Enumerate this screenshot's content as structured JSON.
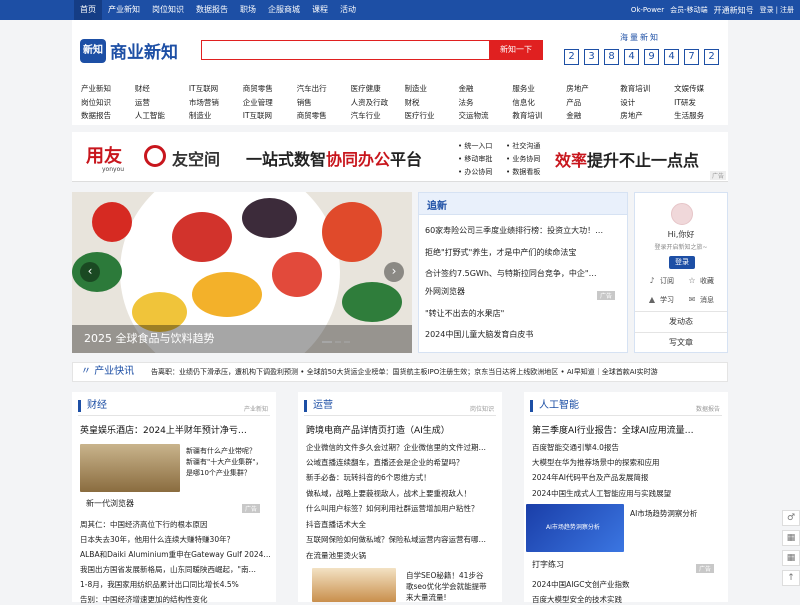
{
  "topnav": {
    "items": [
      "首页",
      "产业新知",
      "岗位知识",
      "数据报告",
      "职场",
      "企服商城",
      "课程",
      "活动"
    ],
    "right": [
      "Ok-Power",
      "会员-移动端",
      "开通新知号",
      "登录",
      "|",
      "注册"
    ]
  },
  "header": {
    "logo_badge": "新知",
    "logo_text": "商业新知",
    "search_placeholder": "",
    "search_button": "新知一下",
    "counter_label": "海量新知",
    "counter_digits": [
      "2",
      "3",
      "8",
      "4",
      "9",
      "4",
      "7",
      "2"
    ]
  },
  "categories": [
    [
      "产业新知",
      "财经",
      "IT互联网",
      "商贸零售",
      "汽车出行",
      "医疗健康",
      "制造业",
      "金融",
      "服务业",
      "房地产",
      "教育培训",
      "文娱传媒"
    ],
    [
      "岗位知识",
      "运营",
      "市场营销",
      "企业管理",
      "销售",
      "人资及行政",
      "财税",
      "法务",
      "信息化",
      "产品",
      "设计",
      "IT研发"
    ],
    [
      "数据报告",
      "人工智能",
      "制造业",
      "IT互联网",
      "商贸零售",
      "汽车行业",
      "医疗行业",
      "交运物流",
      "教育培训",
      "金融",
      "房地产",
      "生活服务"
    ]
  ],
  "banner": {
    "brand": "用友",
    "brand_sub": "yonyou",
    "product": "友空间",
    "slogan_a": "一站式数智",
    "slogan_b": "协同办公",
    "slogan_c": "平台",
    "features": [
      "统一入口",
      "社交沟通",
      "移动审批",
      "业务协同",
      "办公协同",
      "数据看板"
    ],
    "right_a": "效率",
    "right_b": "提升不止一点点",
    "ad": "广告"
  },
  "carousel": {
    "caption": "2025 全球食品与饮料趋势",
    "prev": "‹",
    "next": "›"
  },
  "latest": {
    "title": "追新",
    "items": [
      "60家寿险公司三季度业绩排行榜：投资立大功！…",
      "拒绝\"打野式\"养生，才是中产们的续命法宝",
      "合计签约7.5GWh、与特斯拉同台竞争，中企\"…",
      "外网浏览器",
      "\"转让不出去的水果店\"",
      "2024中国儿童大脑发育白皮书"
    ],
    "ad": "广告"
  },
  "user": {
    "greeting": "Hi,你好",
    "hint": "登录开启新知之旅~",
    "login": "登录",
    "actions": [
      {
        "icon": "bell-icon",
        "glyph": "♪",
        "label": "订阅"
      },
      {
        "icon": "star-icon",
        "glyph": "☆",
        "label": "收藏"
      },
      {
        "icon": "cap-icon",
        "glyph": "▲",
        "label": "学习"
      },
      {
        "icon": "message-icon",
        "glyph": "✉",
        "label": "消息"
      }
    ],
    "link_feed": "发动态",
    "link_write": "写文章"
  },
  "ticker": {
    "label": "产业快讯",
    "text": "告离职：业绩仍下滑承压，遭机构下调盈利预测  •  全球前50大货运企业榜单：国货航主板IPO注册生效；京东当日达将上线欧洲地区  •  AI早知道｜全球首款AI实时游"
  },
  "columns": [
    {
      "title": "财经",
      "more": "产业新知",
      "lead": "英皇娱乐酒店：2024上半财年预计净亏…",
      "thumb_text": [
        "新疆有什么产业带呢？",
        "新疆有\"十大产业集群\"，",
        "是哪10个产业集群？"
      ],
      "thumb_caption": "新一代浏览器",
      "ad": "广告",
      "items": [
        "周其仁：中国经济高位下行的根本原因",
        "日本失去30年，他用什么连续大赚特赚30年？",
        "ALBA和Daiki Aluminium重申在Gateway Gulf 2024…",
        "我国出方国省发展新格局，山东同暖陕西崛起，\"南…",
        "1-8月，我国家用纺织品累计出口同比增长4.5%",
        "告别：中国经济增速更加的结构性变化"
      ]
    },
    {
      "title": "运营",
      "more": "岗位知识",
      "lead": "跨境电商产品详情页打造（AI生成）",
      "items": [
        "企业微信的文件多久会过期？企业微信里的文件过期…",
        "公域直播连续翻车，直播还会是企业的希望吗？",
        "新手必备：玩转抖音的6个思维方式！",
        "做私域，战略上要藐视敌人，战术上要重视敌人！",
        "什么叫用户标签？如何利用社群运营增加用户粘性？",
        "抖音直播话术大全",
        "互联网保险如何做私域？保险私域运营内容运营有哪…",
        "在流量池里烫火锅"
      ],
      "promo": [
        "自学SEO秘籍！41步谷",
        "歌seo优化学会就能提带",
        "来大量流量!"
      ]
    },
    {
      "title": "人工智能",
      "more": "数据报告",
      "lead": "第三季度AI行业报告：全球AI应用流量…",
      "items": [
        "百度智能交通引擎4.0报告",
        "大模型在华为推荐场景中的探索和应用",
        "2024年AI代码平台及产品发展简报",
        "2024中国生成式人工智能应用与实践展望"
      ],
      "thumb_title": "AI市场趋势洞察分析",
      "thumb_side": "AI市场趋势洞察分析",
      "thumb_caption": "打字练习",
      "ad": "广告",
      "more_items": [
        "2024中国AIGC文创产业指数",
        "百度大模型安全的技术实践"
      ]
    }
  ],
  "float": [
    "♂",
    "▦",
    "▦",
    "↑"
  ]
}
